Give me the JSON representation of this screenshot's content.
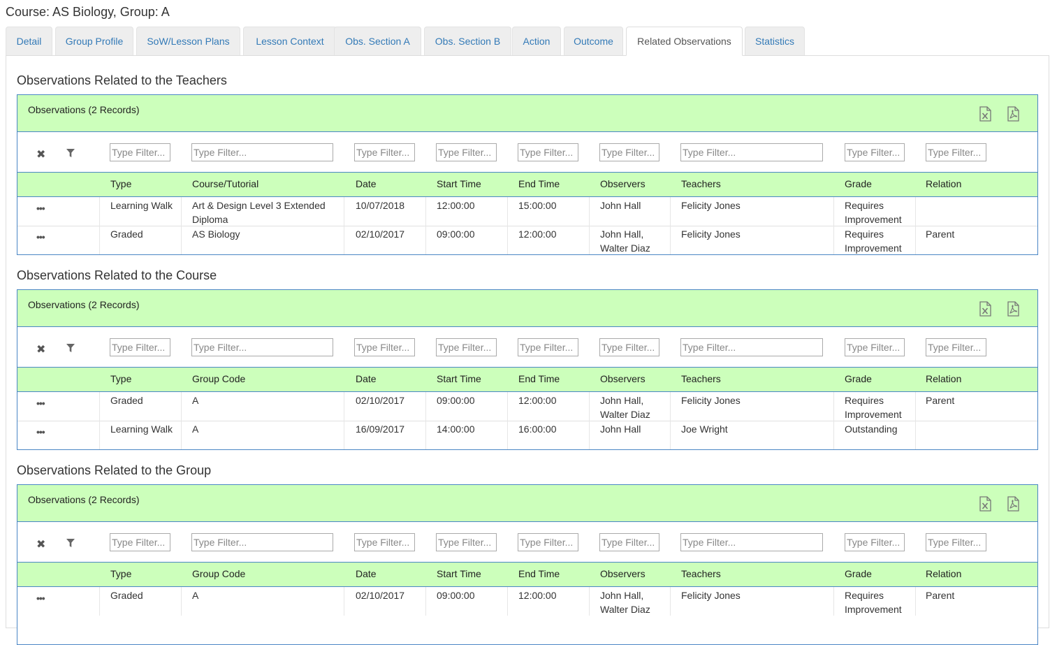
{
  "page_title": "Course: AS Biology, Group: A",
  "tabs": [
    {
      "label": "Detail"
    },
    {
      "label": "Group Profile"
    },
    {
      "label": "SoW/Lesson Plans"
    },
    {
      "label": "Lesson Context"
    },
    {
      "label": "Obs. Section A"
    },
    {
      "label": "Obs. Section B"
    },
    {
      "label": "Action"
    },
    {
      "label": "Outcome"
    },
    {
      "label": "Related Observations",
      "active": true
    },
    {
      "label": "Statistics"
    }
  ],
  "filter_placeholder": "Type Filter...",
  "sections": [
    {
      "heading": "Observations Related to the Teachers",
      "panel_title": "Observations (2 Records)",
      "columns": [
        "Type",
        "Course/Tutorial",
        "Date",
        "Start Time",
        "End Time",
        "Observers",
        "Teachers",
        "Grade",
        "Relation"
      ],
      "rows": [
        [
          "Learning Walk",
          "Art & Design Level 3 Extended Diploma",
          "10/07/2018",
          "12:00:00",
          "15:00:00",
          "John Hall",
          "Felicity Jones",
          "Requires Improvement",
          ""
        ],
        [
          "Graded",
          "AS Biology",
          "02/10/2017",
          "09:00:00",
          "12:00:00",
          "John Hall, Walter Diaz",
          "Felicity Jones",
          "Requires Improvement",
          "Parent"
        ]
      ]
    },
    {
      "heading": "Observations Related to the Course",
      "panel_title": "Observations (2 Records)",
      "columns": [
        "Type",
        "Group Code",
        "Date",
        "Start Time",
        "End Time",
        "Observers",
        "Teachers",
        "Grade",
        "Relation"
      ],
      "rows": [
        [
          "Graded",
          "A",
          "02/10/2017",
          "09:00:00",
          "12:00:00",
          "John Hall, Walter Diaz",
          "Felicity Jones",
          "Requires Improvement",
          "Parent"
        ],
        [
          "Learning Walk",
          "A",
          "16/09/2017",
          "14:00:00",
          "16:00:00",
          "John Hall",
          "Joe Wright",
          "Outstanding",
          ""
        ]
      ]
    },
    {
      "heading": "Observations Related to the Group",
      "panel_title": "Observations (2 Records)",
      "columns": [
        "Type",
        "Group Code",
        "Date",
        "Start Time",
        "End Time",
        "Observers",
        "Teachers",
        "Grade",
        "Relation"
      ],
      "rows": [
        [
          "Graded",
          "A",
          "02/10/2017",
          "09:00:00",
          "12:00:00",
          "John Hall, Walter Diaz",
          "Felicity Jones",
          "Requires Improvement",
          "Parent"
        ]
      ]
    }
  ],
  "icons": {
    "excel": "excel-export-icon",
    "pdf": "pdf-export-icon",
    "clear": "clear-filter-icon",
    "filter": "funnel-icon",
    "row_menu": "ellipsis-icon"
  },
  "colors": {
    "accent_green": "#ccffbb",
    "panel_border": "#4a86c5",
    "link_blue": "#337ab7"
  }
}
